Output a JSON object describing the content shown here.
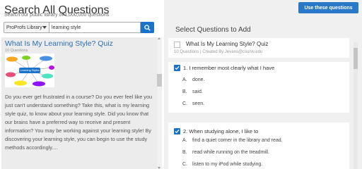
{
  "header": {
    "title": "Search All Questions",
    "subtitle": "Search our public library of 1,000,000 questions"
  },
  "search": {
    "library": "ProProfs Library",
    "query": "learning style"
  },
  "result": {
    "title": "What Is My Learning Style? Quiz",
    "count": "10 Questions",
    "thumb_label": "Learning Styles",
    "description": "Do you ever get frustrated in a course? Do you ever feel like you just can't understand something? Take this, what is my learning style quiz, to know about your learning style. Did you know that our brains have a preferred way to receive and present information? You may be working against your learning style! By discovering your learning style, you can begin to use the study methods accordingly...."
  },
  "right": {
    "use_button": "Use these questions",
    "heading": "Select Questions to Add",
    "quiz": {
      "name": "What Is My Learning Style? Quiz",
      "meta": "10 Questions | Created By Jevans@csuniv.edu"
    },
    "questions": [
      {
        "number": "1.",
        "text": "I remember most clearly what I have",
        "options": [
          {
            "letter": "A.",
            "text": "done."
          },
          {
            "letter": "B.",
            "text": "said."
          },
          {
            "letter": "C.",
            "text": "seen."
          }
        ]
      },
      {
        "number": "2.",
        "text": "When studying alone, I like to",
        "options": [
          {
            "letter": "A.",
            "text": "find a quiet corner in the library and read."
          },
          {
            "letter": "B.",
            "text": "read while running on the treadmill."
          },
          {
            "letter": "C.",
            "text": "listen to my iPod while studying."
          }
        ]
      }
    ]
  },
  "colors": {
    "accent": "#1a73c9",
    "link": "#2a6fb5"
  }
}
